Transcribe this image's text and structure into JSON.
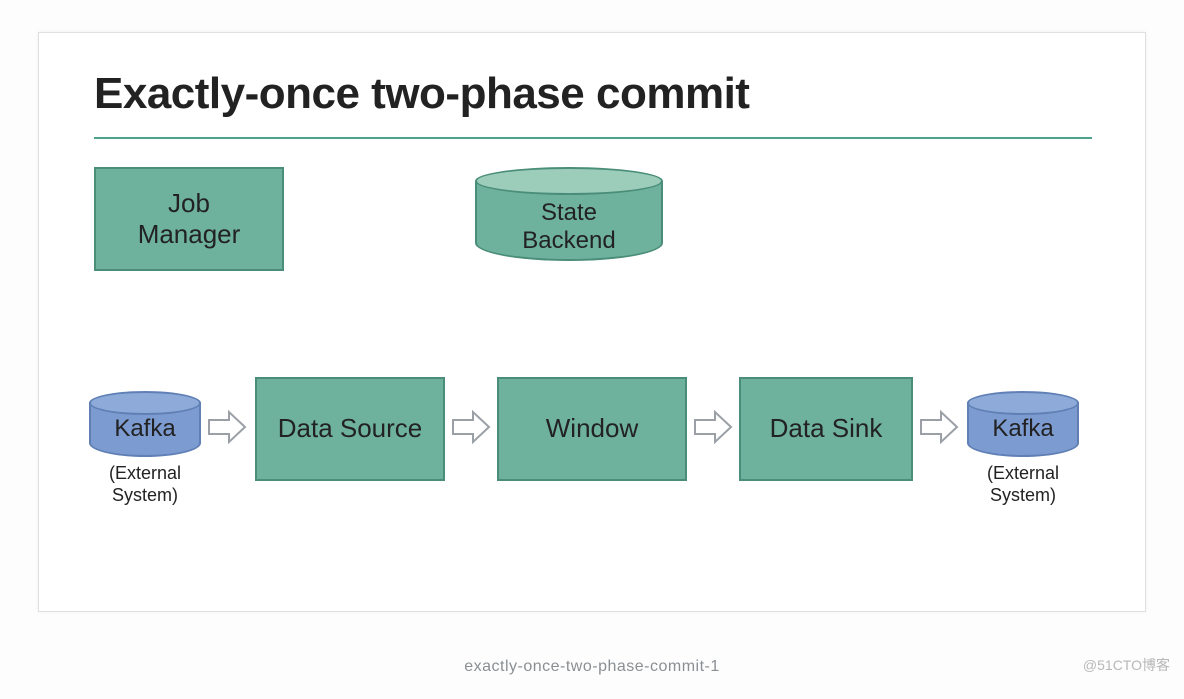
{
  "title": "Exactly-once two-phase commit",
  "boxes": {
    "job_manager": "Job\nManager",
    "state_backend": "State\nBackend",
    "data_source": "Data Source",
    "window": "Window",
    "data_sink": "Data Sink"
  },
  "kafka": {
    "label": "Kafka",
    "sublabel": "(External\nSystem)"
  },
  "caption": "exactly-once-two-phase-commit-1",
  "watermark": "@51CTO博客",
  "colors": {
    "green_fill": "#6eb29d",
    "green_stroke": "#4a8d78",
    "blue_fill": "#7b9bd1",
    "blue_stroke": "#5f7fb5"
  }
}
